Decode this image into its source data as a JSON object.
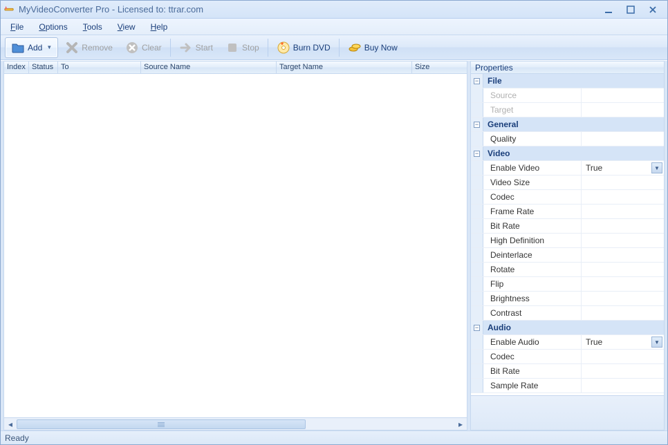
{
  "window": {
    "title": "MyVideoConverter Pro - Licensed to: ttrar.com"
  },
  "menu": {
    "file": "File",
    "options": "Options",
    "tools": "Tools",
    "view": "View",
    "help": "Help"
  },
  "toolbar": {
    "add": "Add",
    "remove": "Remove",
    "clear": "Clear",
    "start": "Start",
    "stop": "Stop",
    "burn": "Burn DVD",
    "buy": "Buy Now"
  },
  "columns": {
    "index": "Index",
    "status": "Status",
    "to": "To",
    "source": "Source Name",
    "target": "Target Name",
    "size": "Size"
  },
  "panel": {
    "header": "Properties"
  },
  "props": {
    "file_section": "File",
    "file_source": "Source",
    "file_target": "Target",
    "general_section": "General",
    "general_quality": "Quality",
    "video_section": "Video",
    "video_enable": "Enable Video",
    "video_enable_val": "True",
    "video_size": "Video Size",
    "video_codec": "Codec",
    "video_framerate": "Frame Rate",
    "video_bitrate": "Bit Rate",
    "video_hd": "High Definition",
    "video_deinterlace": "Deinterlace",
    "video_rotate": "Rotate",
    "video_flip": "Flip",
    "video_brightness": "Brightness",
    "video_contrast": "Contrast",
    "audio_section": "Audio",
    "audio_enable": "Enable Audio",
    "audio_enable_val": "True",
    "audio_codec": "Codec",
    "audio_bitrate": "Bit Rate",
    "audio_samplerate": "Sample Rate"
  },
  "status": {
    "text": "Ready"
  }
}
